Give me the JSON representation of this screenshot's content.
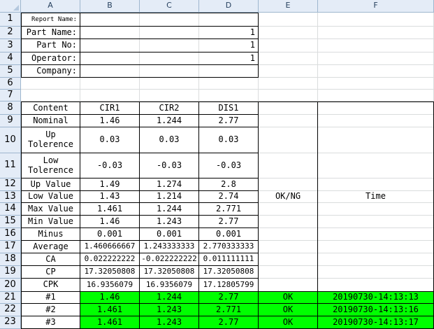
{
  "columns": [
    "A",
    "B",
    "C",
    "D",
    "E",
    "F"
  ],
  "rows": [
    "1",
    "2",
    "3",
    "4",
    "5",
    "6",
    "7",
    "8",
    "9",
    "10",
    "11",
    "12",
    "13",
    "14",
    "15",
    "16",
    "17",
    "18",
    "19",
    "20",
    "21",
    "22",
    "23"
  ],
  "header_block": {
    "report_name_label": "Report Name:",
    "part_name_label": "Part Name:",
    "part_name_value": "1",
    "part_no_label": "Part No:",
    "part_no_value": "1",
    "operator_label": "Operator:",
    "operator_value": "1",
    "company_label": "Company:"
  },
  "table": {
    "content_label": "Content",
    "features": [
      "CIR1",
      "CIR2",
      "DIS1"
    ],
    "ok_ng_label": "OK/NG",
    "time_label": "Time",
    "stats": [
      {
        "label": "Nominal",
        "values": [
          "1.46",
          "1.244",
          "2.77"
        ]
      },
      {
        "label": "Up Tolerence",
        "values": [
          "0.03",
          "0.03",
          "0.03"
        ]
      },
      {
        "label": "Low Tolerence",
        "values": [
          "-0.03",
          "-0.03",
          "-0.03"
        ]
      },
      {
        "label": "Up Value",
        "values": [
          "1.49",
          "1.274",
          "2.8"
        ]
      },
      {
        "label": "Low Value",
        "values": [
          "1.43",
          "1.214",
          "2.74"
        ]
      },
      {
        "label": "Max Value",
        "values": [
          "1.461",
          "1.244",
          "2.771"
        ]
      },
      {
        "label": "Min Value",
        "values": [
          "1.46",
          "1.243",
          "2.77"
        ]
      },
      {
        "label": "Minus",
        "values": [
          "0.001",
          "0.001",
          "0.001"
        ]
      },
      {
        "label": "Average",
        "values": [
          "1.460666667",
          "1.243333333",
          "2.770333333"
        ]
      },
      {
        "label": "CA",
        "values": [
          "0.022222222",
          "-0.022222222",
          "0.011111111"
        ]
      },
      {
        "label": "CP",
        "values": [
          "17.32050808",
          "17.32050808",
          "17.32050808"
        ]
      },
      {
        "label": "CPK",
        "values": [
          "16.9356079",
          "16.9356079",
          "17.12805799"
        ]
      }
    ],
    "samples": [
      {
        "label": "#1",
        "values": [
          "1.46",
          "1.244",
          "2.77"
        ],
        "result": "OK",
        "time": "20190730-14:13:13"
      },
      {
        "label": "#2",
        "values": [
          "1.461",
          "1.243",
          "2.771"
        ],
        "result": "OK",
        "time": "20190730-14:13:16"
      },
      {
        "label": "#3",
        "values": [
          "1.461",
          "1.243",
          "2.77"
        ],
        "result": "OK",
        "time": "20190730-14:13:17"
      }
    ]
  },
  "colors": {
    "ok_fill": "#00ff00",
    "header_bg": "#e4ecf7",
    "gridline": "#dadcdd"
  }
}
